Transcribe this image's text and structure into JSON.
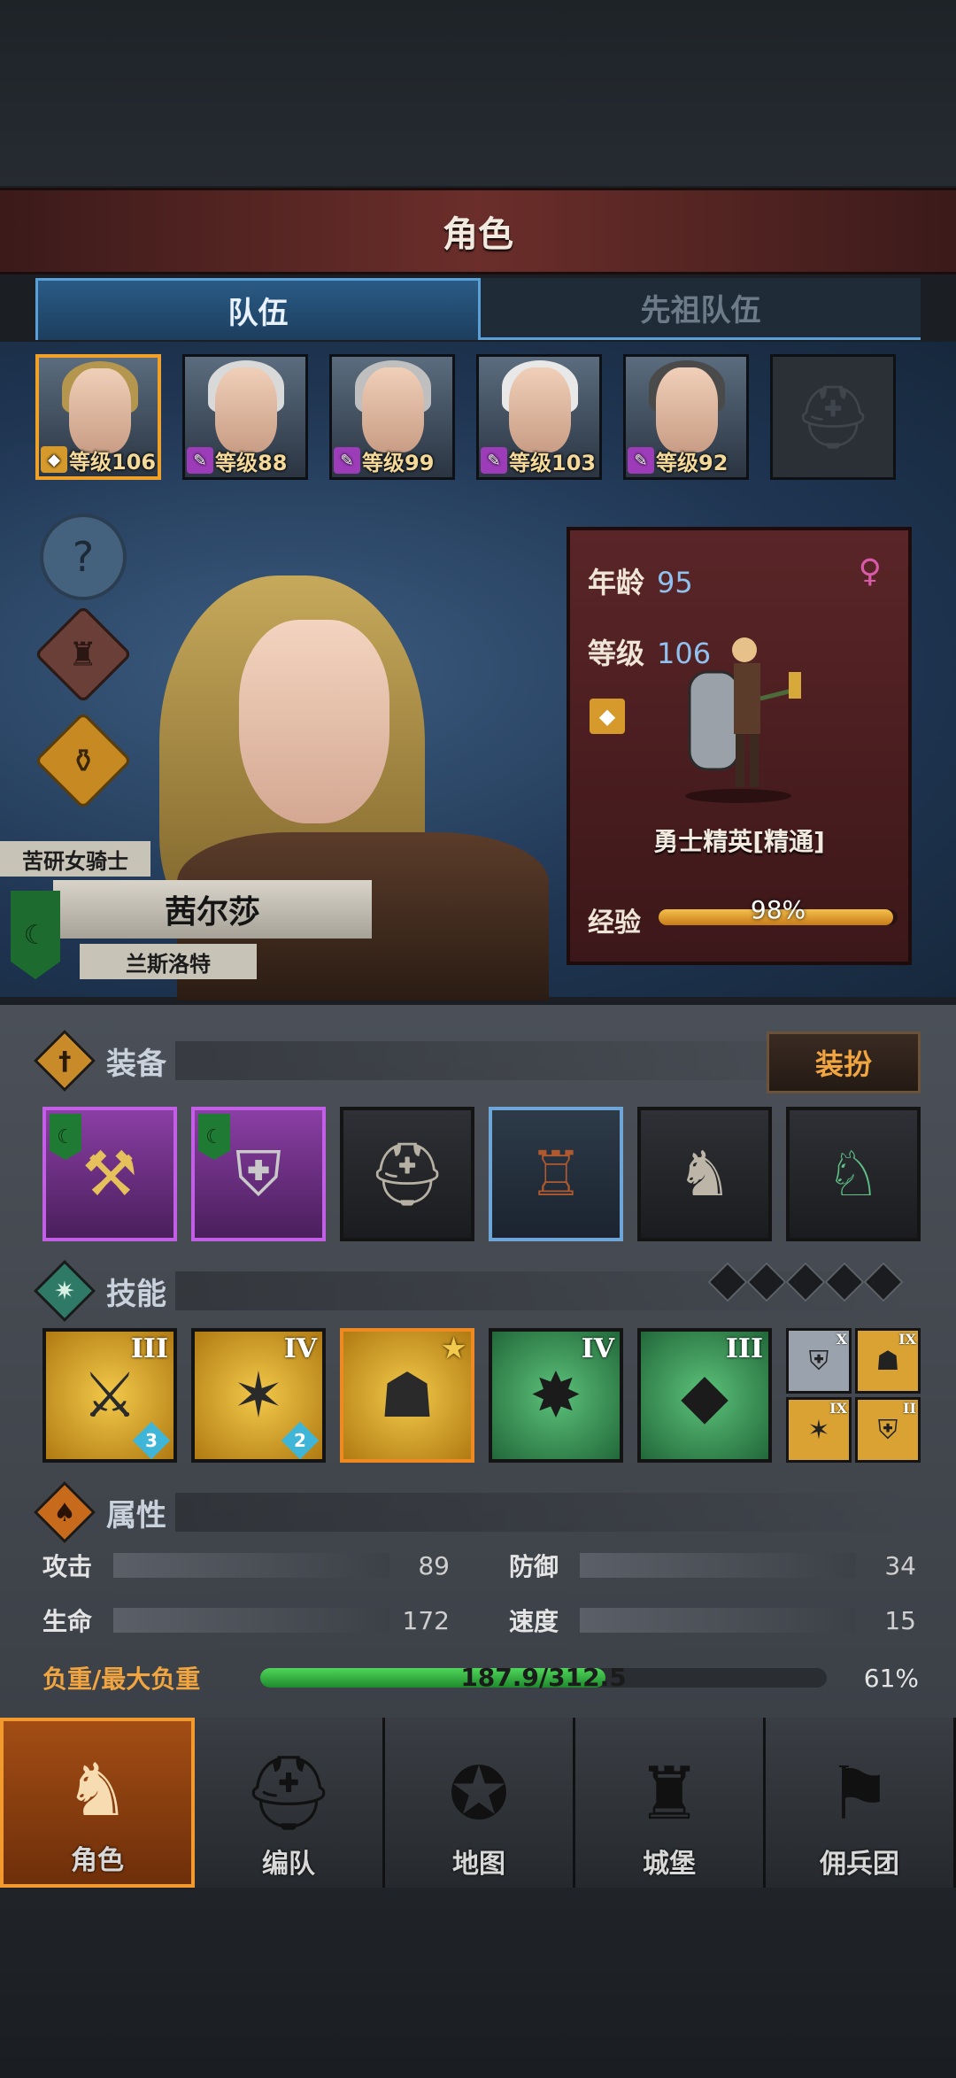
{
  "header": {
    "title": "角色"
  },
  "tabs": [
    {
      "label": "队伍",
      "active": true
    },
    {
      "label": "先祖队伍",
      "active": false
    }
  ],
  "roster": [
    {
      "level_label": "等级106",
      "class": "gold",
      "selected": true
    },
    {
      "level_label": "等级88",
      "class": "purple",
      "selected": false
    },
    {
      "level_label": "等级99",
      "class": "purple",
      "selected": false
    },
    {
      "level_label": "等级103",
      "class": "purple",
      "selected": false
    },
    {
      "level_label": "等级92",
      "class": "purple",
      "selected": false
    },
    {
      "empty": true
    }
  ],
  "side_buttons": [
    {
      "icon": "help-icon",
      "glyph": "?"
    },
    {
      "icon": "hood-icon",
      "glyph": "♜"
    },
    {
      "icon": "potion-icon",
      "glyph": "⚱"
    }
  ],
  "character": {
    "title": "苦研女骑士",
    "name": "茜尔莎",
    "house": "兰斯洛特"
  },
  "info": {
    "age_label": "年龄",
    "age": "95",
    "level_label": "等级",
    "level": "106",
    "class_name": "勇士精英[精通]",
    "exp_label": "经验",
    "exp_value": "98%",
    "exp_fraction": 0.98
  },
  "equipment": {
    "label": "装备",
    "outfit_button": "装扮",
    "items": [
      {
        "name": "hammer-weapon-icon",
        "glyph": "⚒",
        "frame": "purple",
        "flag": true
      },
      {
        "name": "shield-icon",
        "glyph": "⛨",
        "frame": "purple",
        "flag": true
      },
      {
        "name": "helmet-icon",
        "glyph": "⛑",
        "frame": "grey",
        "flag": false
      },
      {
        "name": "armor-icon",
        "glyph": "♖",
        "frame": "blue",
        "flag": false
      },
      {
        "name": "boots-icon",
        "glyph": "♞",
        "frame": "grey",
        "flag": false
      },
      {
        "name": "horse-mount-icon",
        "glyph": "♘",
        "frame": "grey",
        "flag": false
      }
    ]
  },
  "skills": {
    "label": "技能",
    "slots": [
      {
        "name": "shield-sword-skill-icon",
        "glyph": "⚔",
        "color": "gold",
        "rank": "III",
        "charges": "3"
      },
      {
        "name": "shatter-skill-icon",
        "glyph": "✶",
        "color": "gold",
        "rank": "IV",
        "charges": "2"
      },
      {
        "name": "dragon-shield-skill-icon",
        "glyph": "☗",
        "color": "gold",
        "rank": "★",
        "charges": "",
        "selected": true
      },
      {
        "name": "crystal-burst-skill-icon",
        "glyph": "✸",
        "color": "green",
        "rank": "IV",
        "charges": ""
      },
      {
        "name": "crystal-skill-icon",
        "glyph": "◆",
        "color": "green",
        "rank": "III",
        "charges": ""
      }
    ],
    "passives": [
      {
        "name": "passive-shield-icon",
        "glyph": "⛨",
        "rank": "X",
        "color": "#9aa3ad"
      },
      {
        "name": "passive-broken-shield-icon",
        "glyph": "☗",
        "rank": "IX",
        "color": "#d9a233"
      },
      {
        "name": "passive-crack-icon",
        "glyph": "✶",
        "rank": "IX",
        "color": "#d9a233"
      },
      {
        "name": "passive-guard-icon",
        "glyph": "⛨",
        "rank": "II",
        "color": "#d9a233"
      }
    ]
  },
  "attributes": {
    "label": "属性",
    "stats": [
      {
        "label": "攻击",
        "value": "89"
      },
      {
        "label": "防御",
        "value": "34"
      },
      {
        "label": "生命",
        "value": "172"
      },
      {
        "label": "速度",
        "value": "15"
      }
    ],
    "load_label": "负重/最大负重",
    "load_value": "187.9/312.5",
    "load_percent": "61%",
    "load_fraction": 0.61
  },
  "nav": [
    {
      "label": "角色",
      "icon": "knight-icon",
      "glyph": "♞",
      "active": true
    },
    {
      "label": "编队",
      "icon": "helmet-formation-icon",
      "glyph": "⛑",
      "active": false
    },
    {
      "label": "地图",
      "icon": "compass-map-icon",
      "glyph": "✪",
      "active": false
    },
    {
      "label": "城堡",
      "icon": "castle-icon",
      "glyph": "♜",
      "active": false
    },
    {
      "label": "佣兵团",
      "icon": "mercenary-icon",
      "glyph": "⚑",
      "active": false
    }
  ]
}
